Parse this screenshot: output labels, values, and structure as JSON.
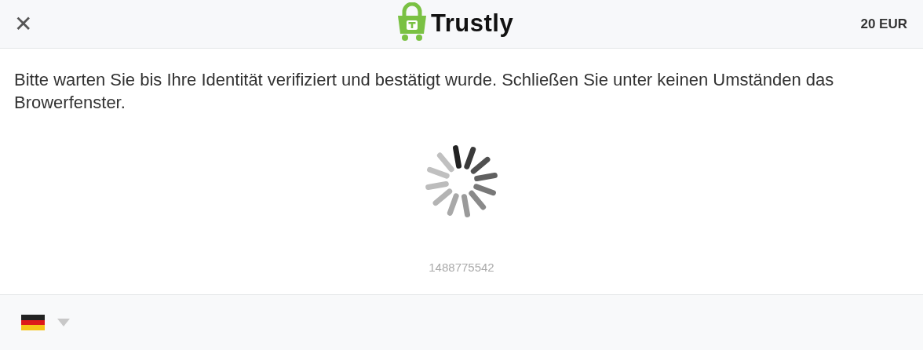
{
  "header": {
    "close": "✕",
    "logo_text": "Trustly",
    "amount": "20 EUR"
  },
  "message": "Bitte warten Sie bis Ihre Identität verifiziert und bestätigt wurde. Schließen Sie unter keinen Umständen das Browerfenster.",
  "reference": "1488775542",
  "footer": {
    "language": {
      "expanded": false
    }
  }
}
